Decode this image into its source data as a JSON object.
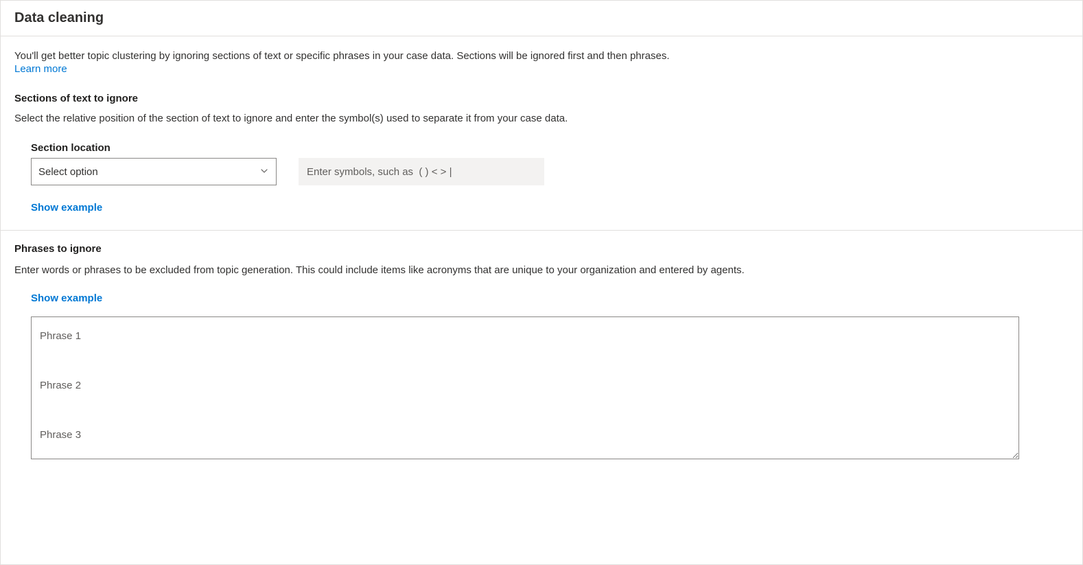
{
  "header": {
    "title": "Data cleaning"
  },
  "intro": {
    "text": "You'll get better topic clustering by ignoring sections of text or specific phrases in your case data. Sections will be ignored first and then phrases.",
    "learn_more": "Learn more"
  },
  "sections": {
    "heading": "Sections of text to ignore",
    "description": "Select the relative position of the section of text to ignore and enter the symbol(s) used to separate it from your case data.",
    "location_label": "Section location",
    "select_placeholder": "Select option",
    "symbols_placeholder": "Enter symbols, such as  ( ) < > |",
    "show_example": "Show example"
  },
  "phrases": {
    "heading": "Phrases to ignore",
    "description": "Enter words or phrases to be excluded from topic generation. This could include items like acronyms that are unique to your organization and entered by agents.",
    "show_example": "Show example",
    "textarea_placeholder": "Phrase 1\n\nPhrase 2\n\nPhrase 3"
  }
}
